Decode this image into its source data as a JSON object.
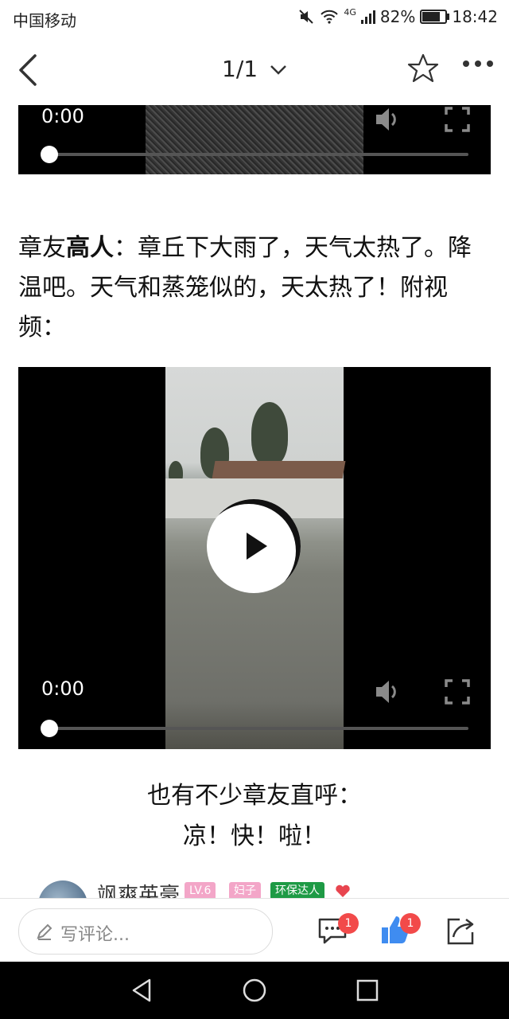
{
  "status": {
    "carrier": "中国移动",
    "network": "4G",
    "battery": "82%",
    "battery_level": 0.82,
    "time": "18:42"
  },
  "nav": {
    "page_indicator": "1/1"
  },
  "video_top": {
    "time": "0:00",
    "progress": 0
  },
  "paragraph": {
    "prefix": "章友",
    "bold": "高人",
    "text": "：章丘下大雨了，天气太热了。降温吧。天气和蒸笼似的，天太热了！附视频："
  },
  "video_main": {
    "time": "0:00",
    "progress": 0
  },
  "caption": {
    "line1": "也有不少章友直呼：",
    "line2": "凉！快！啦！"
  },
  "comment_peek": {
    "username": "飒爽英豪",
    "tags": [
      "LV.6",
      "妇子",
      "环保达人"
    ]
  },
  "bottom_bar": {
    "comment_placeholder": "写评论...",
    "comments_badge": "1",
    "likes_badge": "1"
  },
  "colors": {
    "accent_like": "#3f8cf0",
    "badge": "#f24a4a",
    "tag_pink": "#f3a6c8",
    "tag_green": "#1e9a45"
  }
}
